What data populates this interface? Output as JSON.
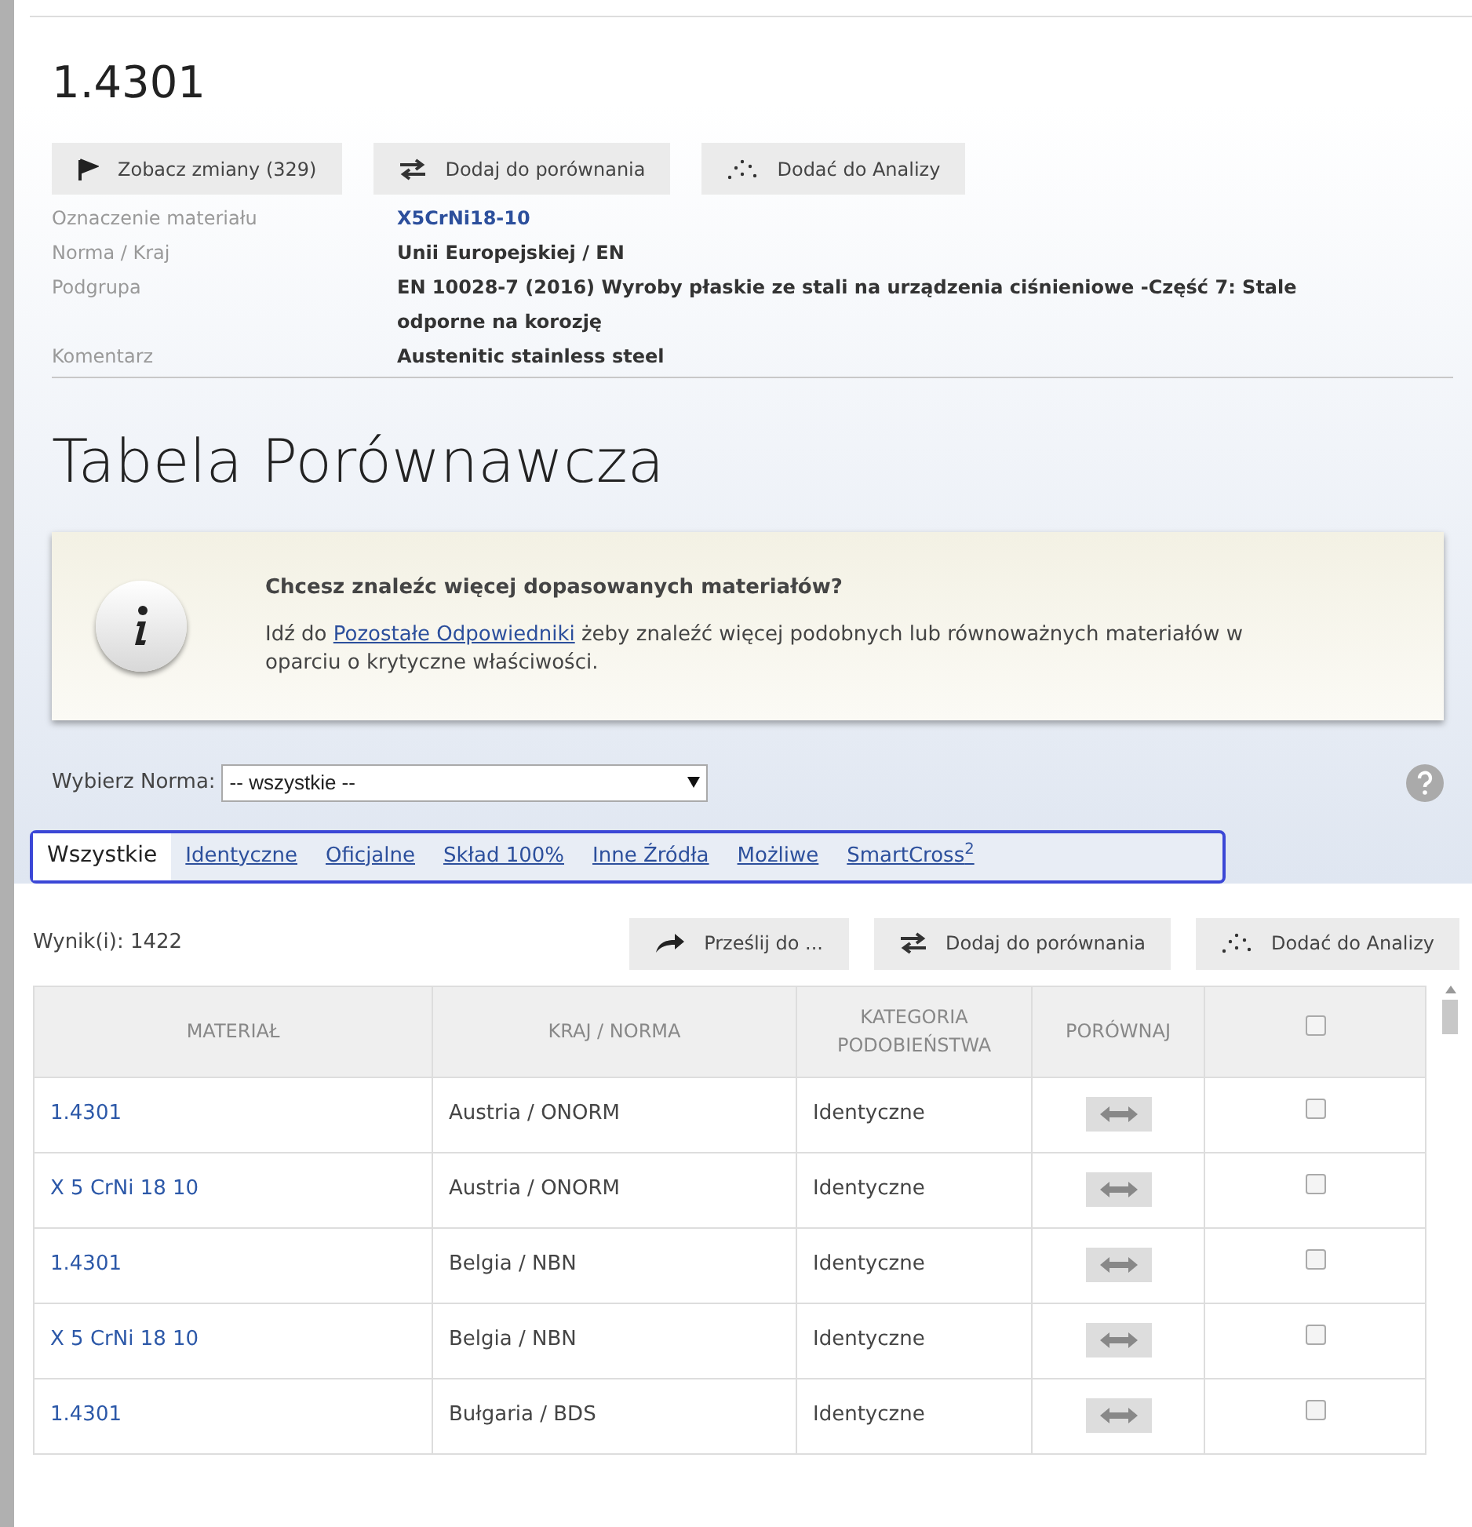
{
  "title": "1.4301",
  "actions": [
    {
      "kind": "flag",
      "label": "Zobacz zmiany (329)"
    },
    {
      "kind": "compare",
      "label": "Dodaj do porównania"
    },
    {
      "kind": "dots",
      "label": "Dodać do Analizy"
    }
  ],
  "details": [
    {
      "label": "Oznaczenie materiału",
      "value": "X5CrNi18-10",
      "kind": "link"
    },
    {
      "label": "Norma / Kraj",
      "value": "Unii Europejskiej / EN",
      "kind": "text"
    },
    {
      "label": "Podgrupa",
      "value": "EN 10028-7 (2016) Wyroby płaskie ze stali na urządzenia ciśnieniowe -Część 7: Stale odporne na korozję",
      "kind": "text"
    },
    {
      "label": "Komentarz",
      "value": "Austenitic stainless steel",
      "kind": "text"
    }
  ],
  "section_title": "Tabela Porównawcza",
  "info": {
    "heading": "Chcesz znaleźc więcej dopasowanych materiałów?",
    "text_before": "Idź do",
    "link": "Pozostałe Odpowiedniki",
    "text_after": "żeby znaleźć więcej podobnych lub równoważnych materiałów w oparciu o krytyczne właściwości."
  },
  "filter": {
    "label": "Wybierz Norma:",
    "value": "-- wszystkie --"
  },
  "tabs": [
    {
      "label": "Wszystkie",
      "selected": true
    },
    {
      "label": "Identyczne",
      "selected": false
    },
    {
      "label": "Oficjalne",
      "selected": false
    },
    {
      "label": "Skład 100%",
      "selected": false
    },
    {
      "label": "Inne Źródła",
      "selected": false
    },
    {
      "label": "Możliwe",
      "selected": false
    },
    {
      "label": "SmartCross$^{2}$",
      "selected": false
    }
  ],
  "results": "Wynik(i): 1422",
  "result_actions": [
    {
      "kind": "forward",
      "label": "Prześlij do ..."
    },
    {
      "kind": "compare",
      "label": "Dodaj do porównania"
    },
    {
      "kind": "dots",
      "label": "Dodać do Analizy"
    }
  ],
  "table": {
    "columns": [
      "MATERIAŁ",
      "KRAJ / NORMA",
      "KATEGORIA PODOBIEŃSTWA",
      "PORÓWNAJ"
    ],
    "all_checked": false,
    "rows": [
      {
        "material": "1.4301",
        "country": "Austria / ONORM",
        "category": "Identyczne",
        "checked": false
      },
      {
        "material": "X 5 CrNi 18 10",
        "country": "Austria / ONORM",
        "category": "Identyczne",
        "checked": false
      },
      {
        "material": "1.4301",
        "country": "Belgia / NBN",
        "category": "Identyczne",
        "checked": false
      },
      {
        "material": "X 5 CrNi 18 10",
        "country": "Belgia / NBN",
        "category": "Identyczne",
        "checked": false
      },
      {
        "material": "1.4301",
        "country": "Bułgaria / BDS",
        "category": "Identyczne",
        "checked": false
      }
    ]
  }
}
